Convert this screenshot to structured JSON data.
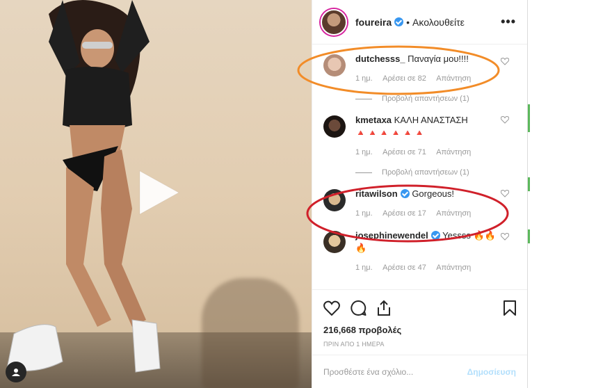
{
  "post": {
    "username": "foureira",
    "separator": "•",
    "follow_status": "Ακολουθείτε",
    "more_label": "•••"
  },
  "comments": [
    {
      "username": "dutchesss_",
      "verified": false,
      "text": "Παναγία μου!!!!",
      "time": "1 ημ.",
      "likes": "Αρέσει σε 82",
      "reply": "Απάντηση",
      "replies": "Προβολή απαντήσεων (1)"
    },
    {
      "username": "kmetaxa",
      "verified": false,
      "text": "ΚΑΛΗ ΑΝΑΣΤΑΣΗ",
      "emoji": "🔺🔺🔺🔺🔺🔺",
      "time": "1 ημ.",
      "likes": "Αρέσει σε 71",
      "reply": "Απάντηση",
      "replies": "Προβολή απαντήσεων (1)"
    },
    {
      "username": "ritawilson",
      "verified": true,
      "text": "Gorgeous!",
      "time": "1 ημ.",
      "likes": "Αρέσει σε 17",
      "reply": "Απάντηση"
    },
    {
      "username": "josephinewendel",
      "verified": true,
      "text": "Yessss 🔥🔥🔥",
      "time": "1 ημ.",
      "likes": "Αρέσει σε 47",
      "reply": "Απάντηση"
    }
  ],
  "stats": {
    "views": "216,668 προβολές",
    "posted": "ΠΡΙΝ ΑΠΟ 1 ΗΜΕΡΑ"
  },
  "composer": {
    "placeholder": "Προσθέστε ένα σχόλιο...",
    "post_label": "Δημοσίευση"
  },
  "annotations": {
    "highlight_1_color": "#f28c28",
    "highlight_2_color": "#d0202a"
  },
  "colors": {
    "verified": "#3897f0",
    "story_ring": "#d6249f",
    "muted": "#999999",
    "text": "#262626"
  }
}
